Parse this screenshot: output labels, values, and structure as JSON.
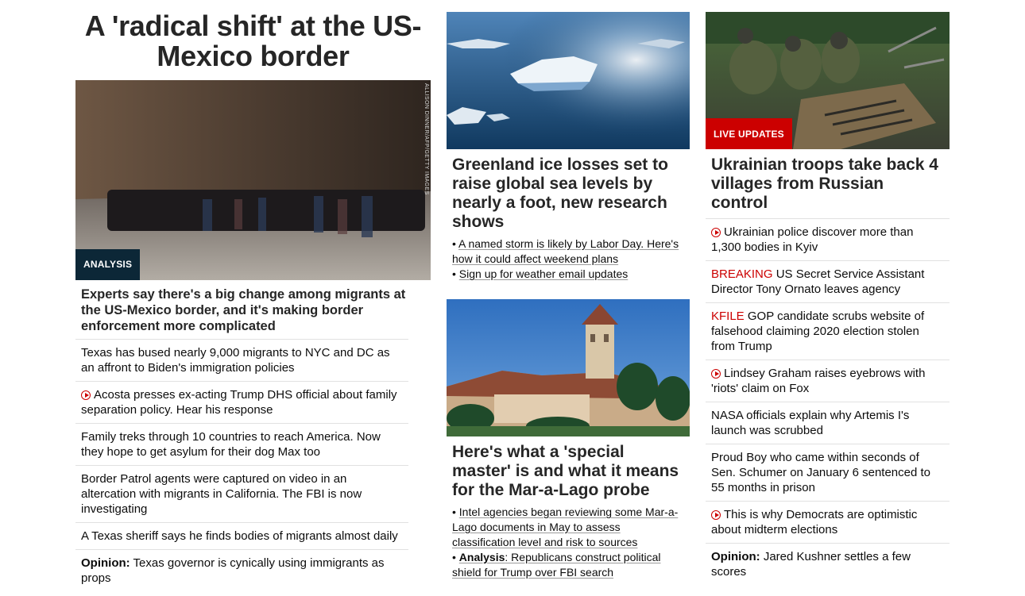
{
  "left": {
    "top_headline": "A 'radical shift' at the US-Mexico border",
    "image_badge": "ANALYSIS",
    "image_credit": "ALLISON DINNER/AFP/GETTY IMAGES",
    "card_title": "Experts say there's a big change among migrants at the US-Mexico border, and it's making border enforcement more complicated",
    "items": [
      {
        "text": "Texas has bused nearly 9,000 migrants to NYC and DC as an affront to Biden's immigration policies"
      },
      {
        "video": true,
        "text": "Acosta presses ex-acting Trump DHS official about family separation policy. Hear his response"
      },
      {
        "text": "Family treks through 10 countries to reach America. Now they hope to get asylum for their dog Max too"
      },
      {
        "text": "Border Patrol agents were captured on video in an altercation with migrants in California. The FBI is now investigating"
      },
      {
        "text": "A Texas sheriff says he finds bodies of migrants almost daily"
      },
      {
        "prefix": "Opinion:",
        "text": " Texas governor is cynically using immigrants as props"
      }
    ]
  },
  "middle": {
    "card1": {
      "title": "Greenland ice losses set to raise global sea levels by nearly a foot, new research shows",
      "links": [
        {
          "bullet": "• ",
          "text": "A named storm is likely by Labor Day. Here's how it could affect weekend plans"
        },
        {
          "bullet": "• ",
          "text": "Sign up for weather email updates"
        }
      ]
    },
    "card2": {
      "title": "Here's what a 'special master' is and what it means for the Mar-a-Lago probe",
      "links": [
        {
          "bullet": "• ",
          "text": "Intel agencies began reviewing some Mar-a-Lago documents in May to assess classification level and risk to sources"
        },
        {
          "bullet": "• ",
          "prefix": "Analysis",
          "text": ": Republicans construct political shield for Trump over FBI search"
        }
      ]
    }
  },
  "right": {
    "image_badge": "LIVE UPDATES",
    "card_title": "Ukrainian troops take back 4 villages from Russian control",
    "items": [
      {
        "video": true,
        "text": "Ukrainian police discover more than 1,300 bodies in Kyiv"
      },
      {
        "label": "BREAKING",
        "text": " US Secret Service Assistant Director Tony Ornato leaves agency"
      },
      {
        "label": "KFILE",
        "text": " GOP candidate scrubs website of falsehood claiming 2020 election stolen from Trump"
      },
      {
        "video": true,
        "text": "Lindsey Graham raises eyebrows with 'riots' claim on Fox"
      },
      {
        "text": "NASA officials explain why Artemis I's launch was scrubbed"
      },
      {
        "text": "Proud Boy who came within seconds of Sen. Schumer on January 6 sentenced to 55 months in prison"
      },
      {
        "video": true,
        "text": "This is why Democrats are optimistic about midterm elections"
      },
      {
        "prefix": "Opinion:",
        "text": " Jared Kushner settles a few scores"
      }
    ]
  },
  "colors": {
    "accent_red": "#cc0000",
    "badge_dark": "#0c2737",
    "divider": "#e1e1e1",
    "text": "#0c0c0c"
  }
}
